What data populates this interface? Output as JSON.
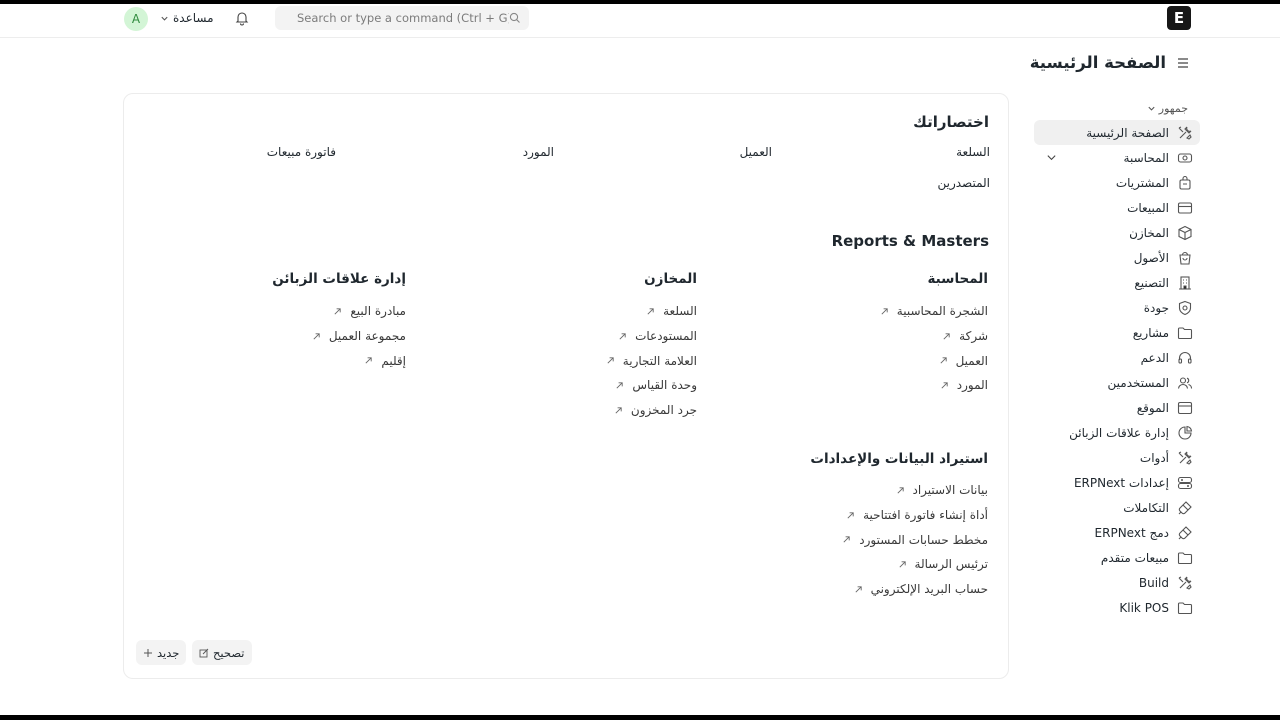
{
  "navbar": {
    "logo_letter": "E",
    "search_placeholder": "Search or type a command (Ctrl + G)",
    "help_label": "مساعدة",
    "avatar_letter": "A"
  },
  "page": {
    "title": "الصفحة الرئيسية"
  },
  "sidebar": {
    "section_label": "جمهور",
    "items": [
      {
        "label": "الصفحة الرئيسية",
        "icon": "tools-icon",
        "active": true
      },
      {
        "label": "المحاسبة",
        "icon": "accounting-icon",
        "expandable": true
      },
      {
        "label": "المشتريات",
        "icon": "bag-icon"
      },
      {
        "label": "المبيعات",
        "icon": "card-icon"
      },
      {
        "label": "المخازن",
        "icon": "box-icon"
      },
      {
        "label": "الأصول",
        "icon": "shopping-bag-icon"
      },
      {
        "label": "التصنيع",
        "icon": "building-icon"
      },
      {
        "label": "جودة",
        "icon": "shield-icon"
      },
      {
        "label": "مشاريع",
        "icon": "folder-icon"
      },
      {
        "label": "الدعم",
        "icon": "headset-icon"
      },
      {
        "label": "المستخدمين",
        "icon": "users-icon"
      },
      {
        "label": "الموقع",
        "icon": "web-icon"
      },
      {
        "label": "إدارة علاقات الزبائن",
        "icon": "pie-chart-icon"
      },
      {
        "label": "أدوات",
        "icon": "tools-icon"
      },
      {
        "label": "إعدادات ERPNext",
        "icon": "settings-icon"
      },
      {
        "label": "التكاملات",
        "icon": "integration-icon"
      },
      {
        "label": "دمج ERPNext",
        "icon": "integration-icon"
      },
      {
        "label": "مبيعات متقدم",
        "icon": "folder-icon"
      },
      {
        "label": "Build",
        "icon": "tools-icon"
      },
      {
        "label": "Klik POS",
        "icon": "folder-icon"
      }
    ]
  },
  "shortcuts": {
    "title": "اختصاراتك",
    "items": [
      "السلعة",
      "العميل",
      "المورد",
      "فاتورة مبيعات",
      "المتصدرين"
    ]
  },
  "reports": {
    "title": "Reports & Masters",
    "columns": [
      {
        "title": "المحاسبة",
        "links": [
          "الشجرة المحاسبية",
          "شركة",
          "العميل",
          "المورد"
        ]
      },
      {
        "title": "المخازن",
        "links": [
          "السلعة",
          "المستودعات",
          "العلامة التجارية",
          "وحدة القياس",
          "جرد المخزون"
        ]
      },
      {
        "title": "إدارة علاقات الزبائن",
        "links": [
          "مبادرة البيع",
          "مجموعة العميل",
          "إقليم"
        ]
      },
      {
        "title": "استيراد البيانات والإعدادات",
        "links": [
          "بيانات الاستيراد",
          "أداة إنشاء فاتورة افتتاحية",
          "مخطط حسابات المستورد",
          "ترئيس الرسالة",
          "حساب البريد الإلكتروني"
        ]
      }
    ]
  },
  "buttons": {
    "edit_label": "تصحيح",
    "new_label": "جديد"
  }
}
